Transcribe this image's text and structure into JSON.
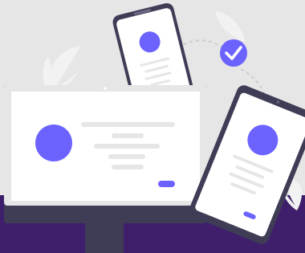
{
  "illustration": {
    "subject": "responsive-devices-sync",
    "colors": {
      "background": "#e6e6e6",
      "floor": "#3f1f6b",
      "accent": "#6c63ff",
      "device_frame": "#3f3d56",
      "screen": "#ffffff",
      "placeholder_line": "#e6e6e6",
      "leaf": "#f2f2f2",
      "dashed_arc": "#cccccc"
    },
    "icons": {
      "sync_badge": "check-circle-icon",
      "avatar": "user-avatar-circle"
    }
  }
}
